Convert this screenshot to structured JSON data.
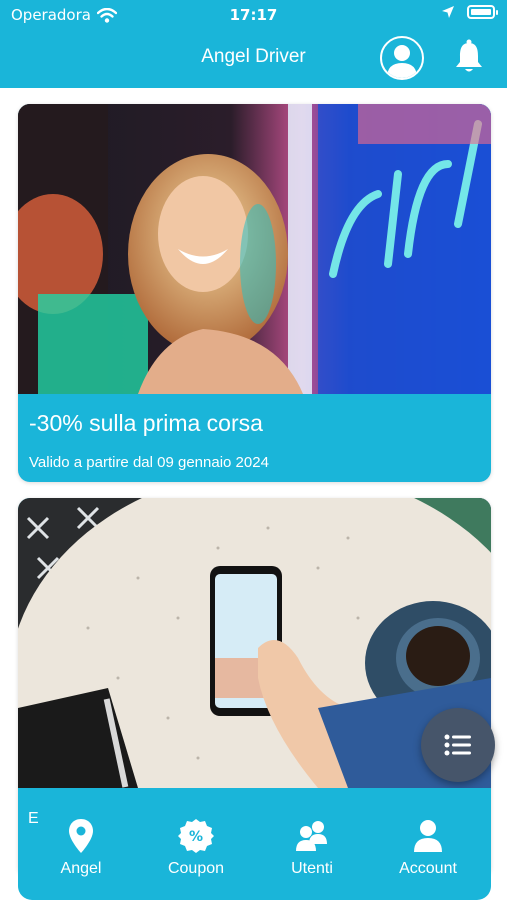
{
  "status_bar": {
    "carrier": "Operadora",
    "time": "17:17",
    "wifi_icon": "wifi-icon",
    "location_icon": "location-arrow-icon",
    "battery_icon": "battery-icon"
  },
  "header": {
    "title": "Angel Driver",
    "profile_icon": "user-avatar-icon",
    "notification_icon": "bell-icon",
    "background_color": "#1ab5d9"
  },
  "offers": [
    {
      "title": "-30% sulla prima corsa",
      "subtitle": "Valido a partire dal 09 gennaio 2024",
      "image": "woman-laughing-neon-lights-photo"
    },
    {
      "title": "",
      "subtitle": "",
      "image": "hand-holding-smartphone-coffee-photo",
      "partial_text": "E"
    }
  ],
  "fab": {
    "icon": "list-menu-icon",
    "color": "#46556a"
  },
  "tabbar": {
    "items": [
      {
        "label": "Angel",
        "icon": "map-pin-icon"
      },
      {
        "label": "Coupon",
        "icon": "percent-badge-icon"
      },
      {
        "label": "Utenti",
        "icon": "users-icon"
      },
      {
        "label": "Account",
        "icon": "account-icon"
      }
    ]
  }
}
